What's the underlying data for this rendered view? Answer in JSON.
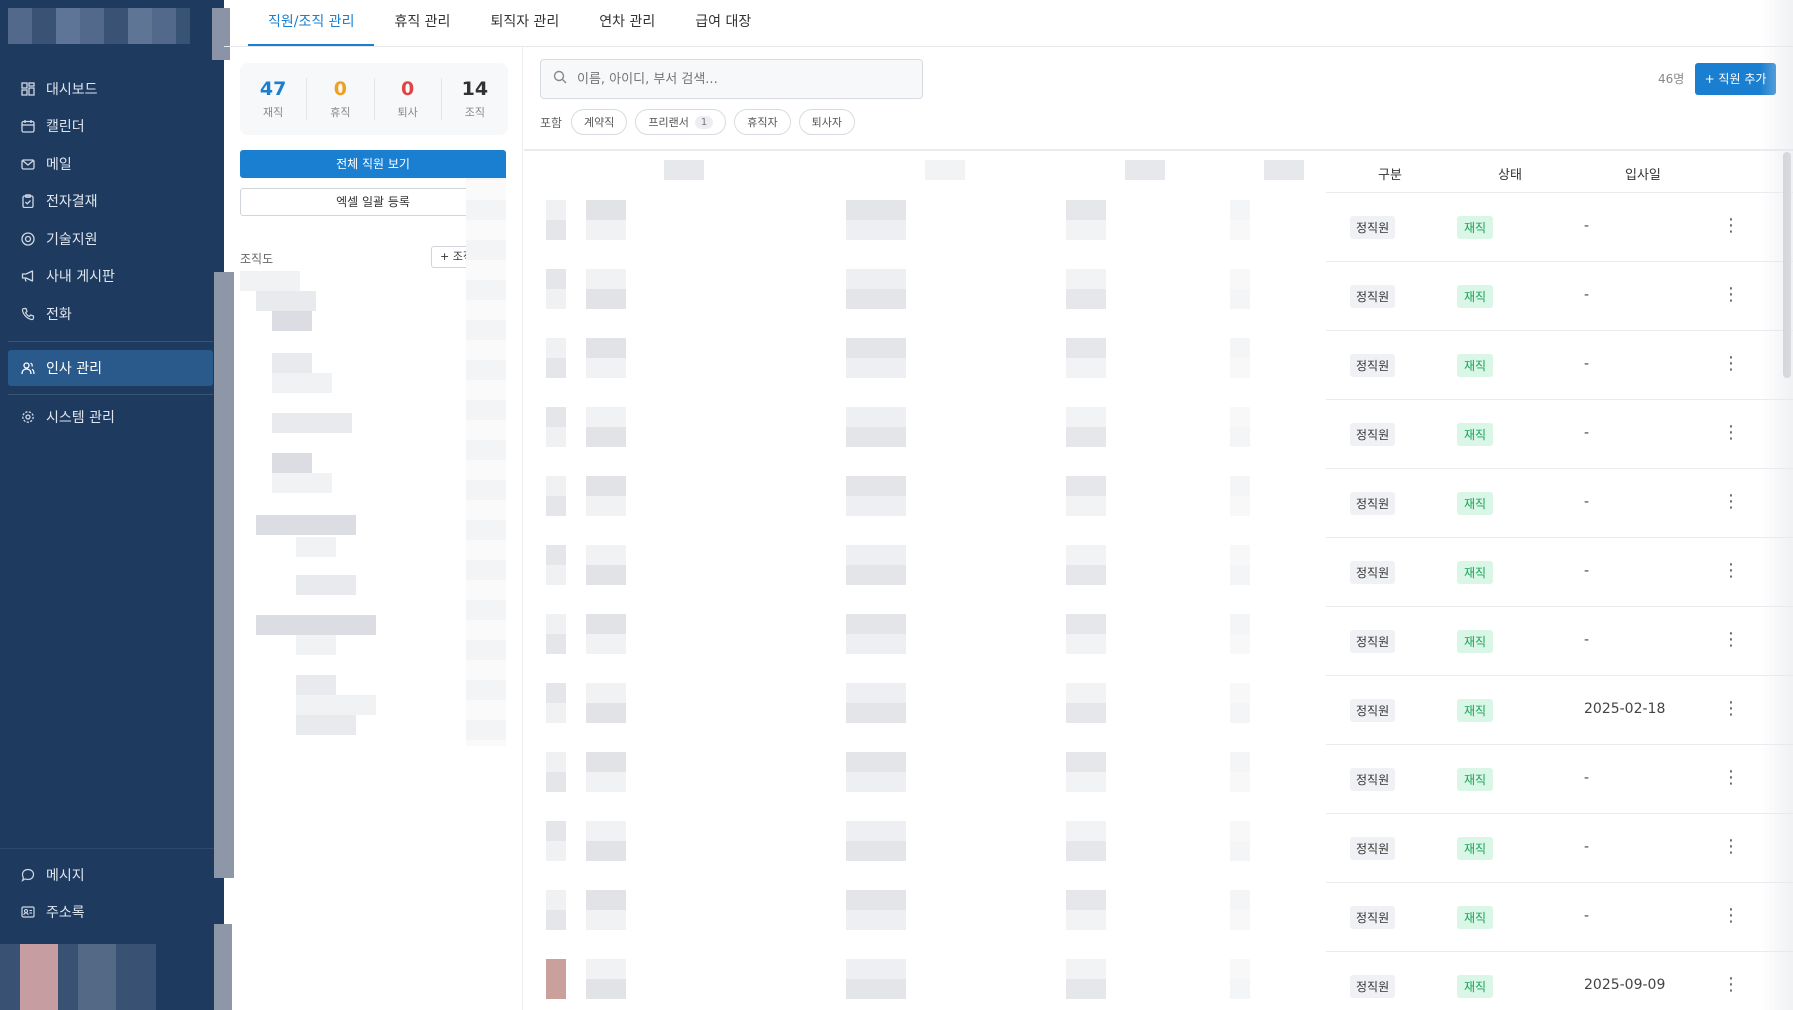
{
  "top_tabs": [
    "직원/조직 관리",
    "휴직 관리",
    "퇴직자 관리",
    "연차 관리",
    "급여 대장"
  ],
  "sidebar": {
    "items": [
      {
        "label": "대시보드",
        "icon": "dashboard-icon"
      },
      {
        "label": "캘린더",
        "icon": "calendar-icon"
      },
      {
        "label": "메일",
        "icon": "mail-icon"
      },
      {
        "label": "전자결재",
        "icon": "clipboard-icon"
      },
      {
        "label": "기술지원",
        "icon": "lifebuoy-icon"
      },
      {
        "label": "사내 게시판",
        "icon": "megaphone-icon"
      },
      {
        "label": "전화",
        "icon": "phone-icon"
      }
    ],
    "active_item": {
      "label": "인사 관리",
      "icon": "users-icon"
    },
    "system_item": {
      "label": "시스템 관리",
      "icon": "gear-icon"
    },
    "bottom_items": [
      {
        "label": "메시지",
        "icon": "message-icon"
      },
      {
        "label": "주소록",
        "icon": "contacts-icon"
      }
    ]
  },
  "stats": [
    {
      "value": "47",
      "label": "재직",
      "color": "#1a7fd0"
    },
    {
      "value": "0",
      "label": "휴직",
      "color": "#f0a020"
    },
    {
      "value": "0",
      "label": "퇴사",
      "color": "#e04545"
    },
    {
      "value": "14",
      "label": "조직",
      "color": "#333333"
    }
  ],
  "left_panel": {
    "view_all_button": "전체 직원 보기",
    "excel_button": "엑셀 일괄 등록",
    "org_chart_label": "조직도",
    "add_org_button": "+ 조직"
  },
  "search": {
    "placeholder": "이름, 아이디, 부서 검색..."
  },
  "employee_count": "46명",
  "add_employee_button": "+ 직원 추가",
  "filter": {
    "label": "포함",
    "chips": [
      {
        "label": "계약직",
        "badge": ""
      },
      {
        "label": "프리랜서",
        "badge": "1"
      },
      {
        "label": "휴직자",
        "badge": ""
      },
      {
        "label": "퇴사자",
        "badge": ""
      }
    ]
  },
  "table": {
    "headers": {
      "type": "구분",
      "status": "상태",
      "hire_date": "입사일"
    },
    "rows": [
      {
        "type": "정직원",
        "status": "재직",
        "hire_date": "-"
      },
      {
        "type": "정직원",
        "status": "재직",
        "hire_date": "-"
      },
      {
        "type": "정직원",
        "status": "재직",
        "hire_date": "-"
      },
      {
        "type": "정직원",
        "status": "재직",
        "hire_date": "-"
      },
      {
        "type": "정직원",
        "status": "재직",
        "hire_date": "-"
      },
      {
        "type": "정직원",
        "status": "재직",
        "hire_date": "-"
      },
      {
        "type": "정직원",
        "status": "재직",
        "hire_date": "-"
      },
      {
        "type": "정직원",
        "status": "재직",
        "hire_date": "2025-02-18"
      },
      {
        "type": "정직원",
        "status": "재직",
        "hire_date": "-"
      },
      {
        "type": "정직원",
        "status": "재직",
        "hire_date": "-"
      },
      {
        "type": "정직원",
        "status": "재직",
        "hire_date": "-"
      },
      {
        "type": "정직원",
        "status": "재직",
        "hire_date": "2025-09-09"
      }
    ]
  }
}
